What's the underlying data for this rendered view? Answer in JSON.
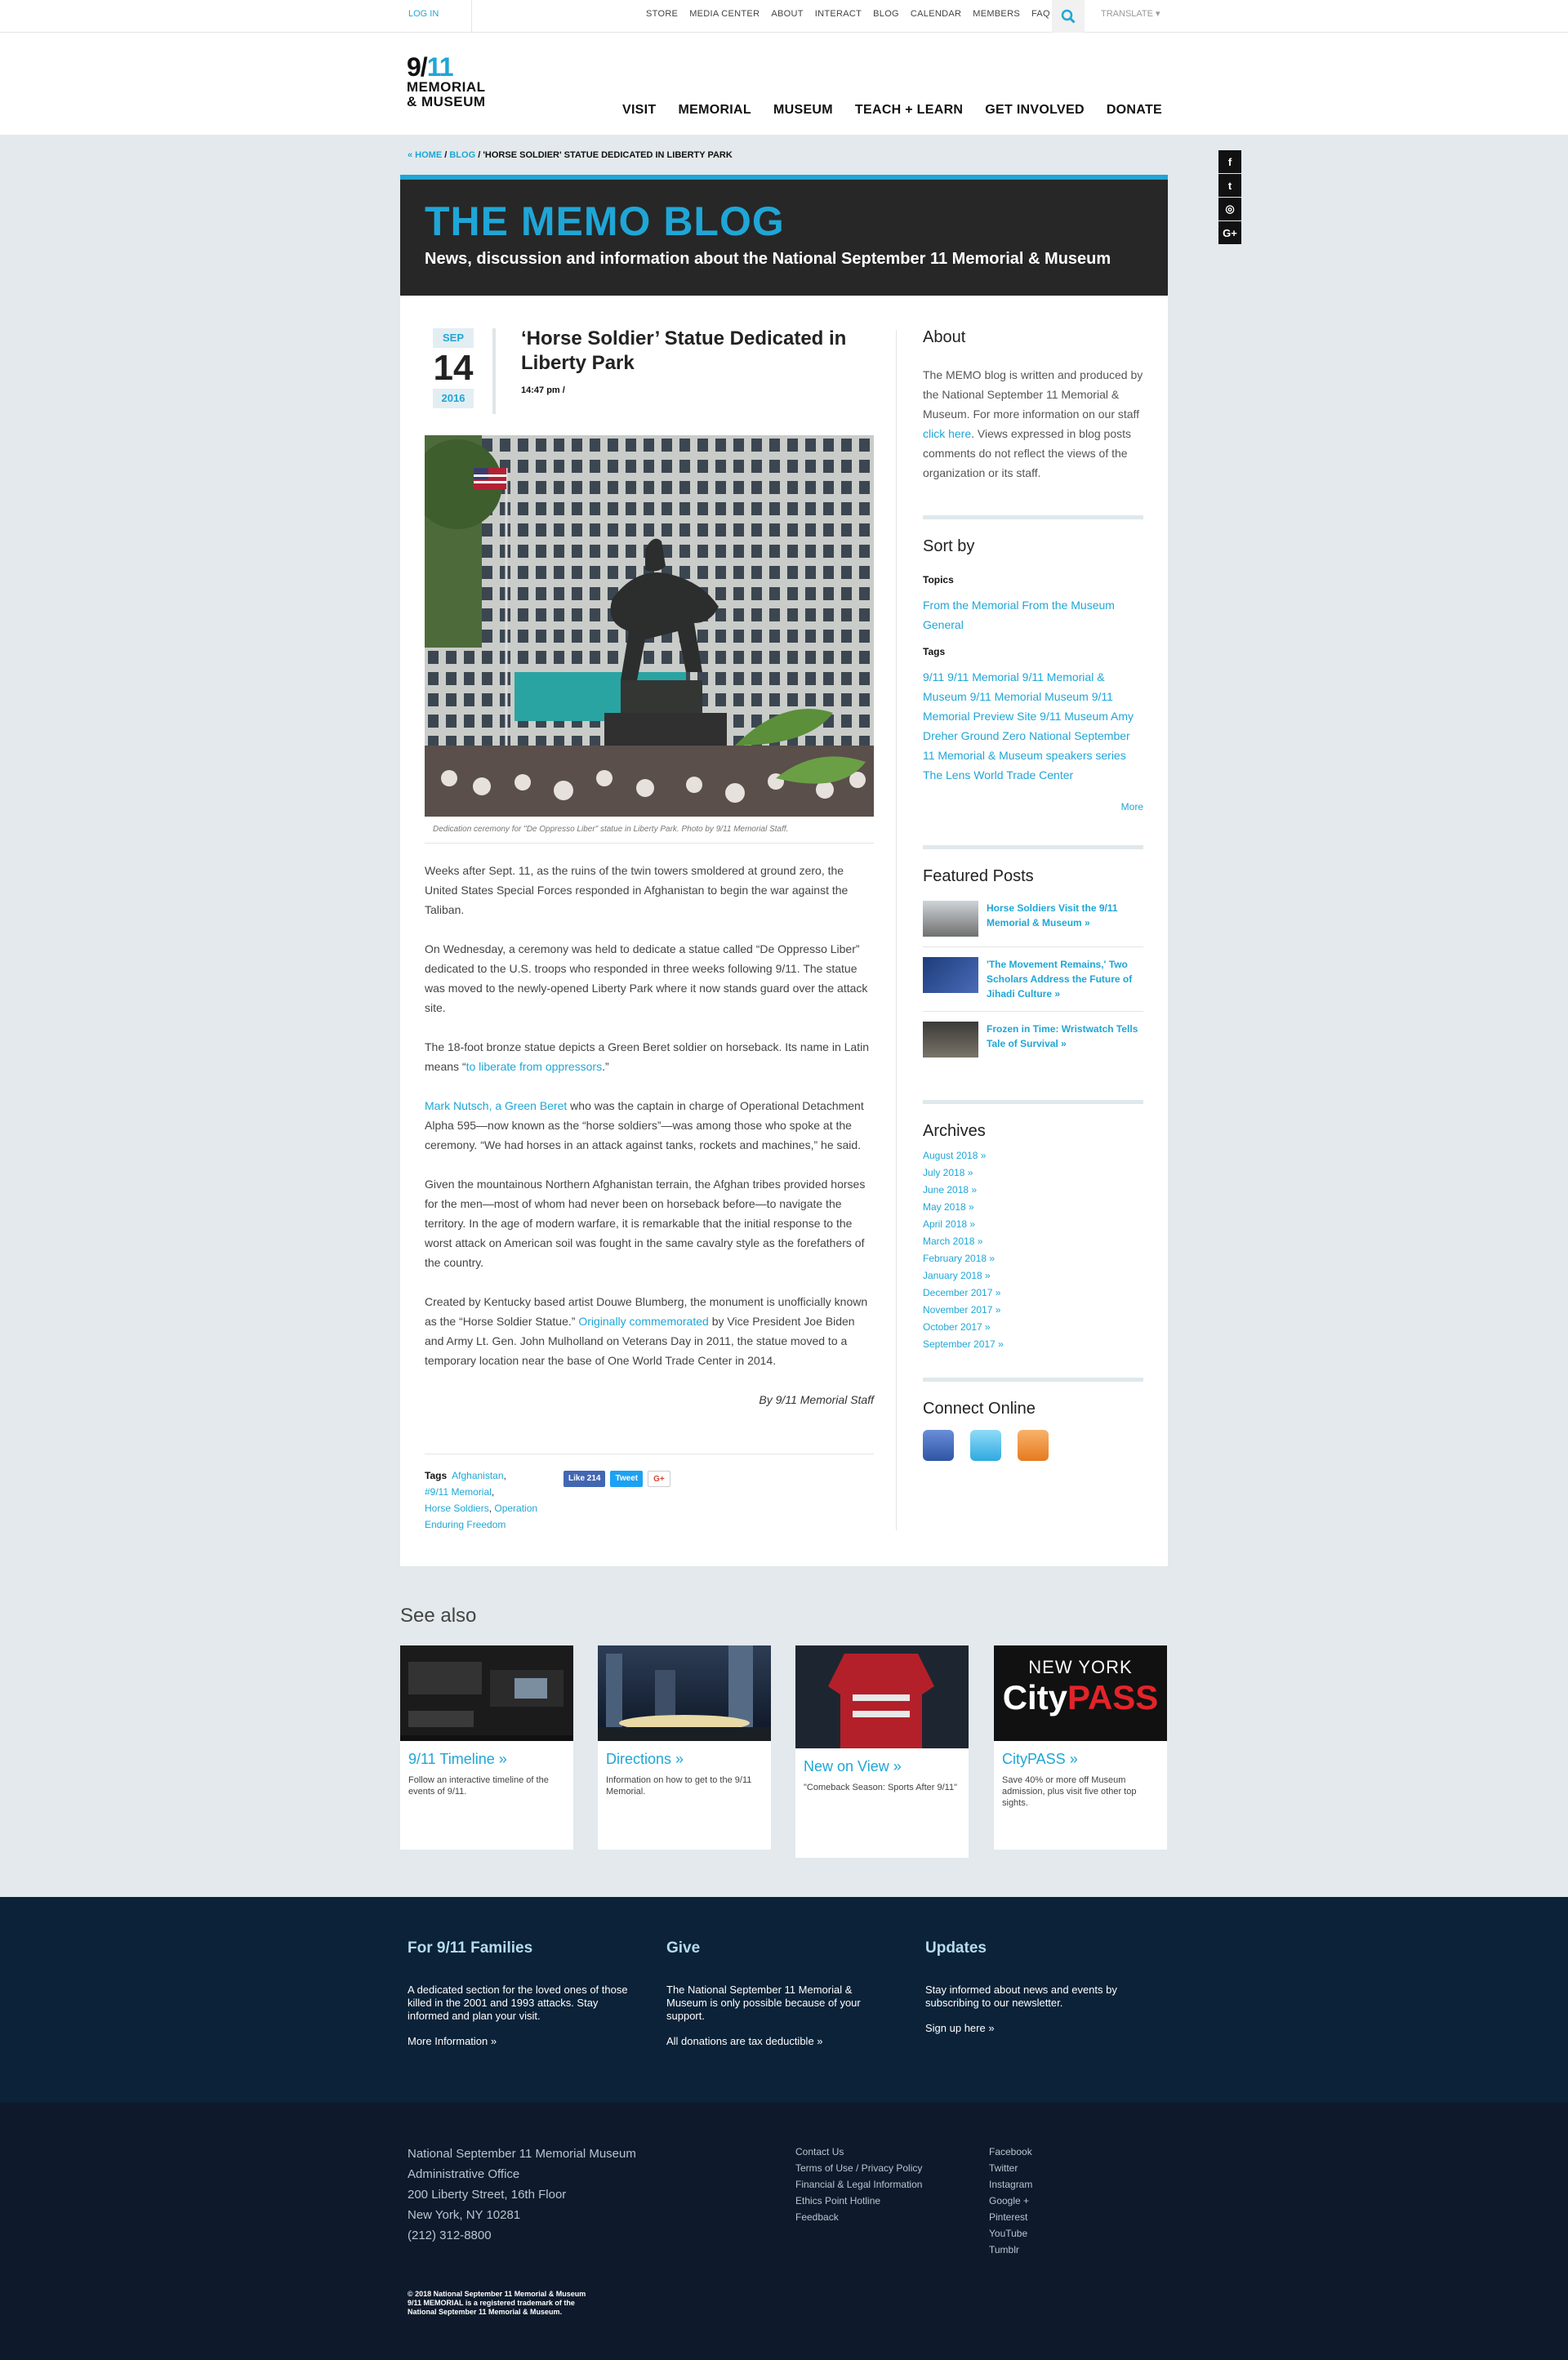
{
  "util": {
    "login": "LOG IN",
    "links": [
      "STORE",
      "MEDIA CENTER",
      "ABOUT",
      "INTERACT",
      "BLOG",
      "CALENDAR",
      "MEMBERS",
      "FAQ"
    ],
    "translate": "TRANSLATE ▾"
  },
  "logo": {
    "line1a": "9/",
    "line1b": "11",
    "line2": "MEMORIAL",
    "line3": "& MUSEUM"
  },
  "nav": [
    "VISIT",
    "MEMORIAL",
    "MUSEUM",
    "TEACH + LEARN",
    "GET INVOLVED",
    "DONATE"
  ],
  "breadcrumb": {
    "home": "« HOME",
    "blog": "BLOG",
    "sep": " / ",
    "current": "'HORSE SOLDIER' STATUE DEDICATED IN LIBERTY PARK"
  },
  "social_bar": [
    "f",
    "t",
    "◎",
    "G+"
  ],
  "banner": {
    "title": "THE MEMO BLOG",
    "subtitle": "News, discussion and information about the National September 11 Memorial & Museum"
  },
  "article": {
    "month": "SEP",
    "day": "14",
    "year": "2016",
    "title": "‘Horse Soldier’ Statue Dedicated in Liberty Park",
    "time": "14:47 pm /",
    "caption": "Dedication ceremony for \"De Oppresso Liber\" statue in Liberty Park. Photo by 9/11 Memorial Staff.",
    "p1": "Weeks after Sept. 11, as the ruins of the twin towers smoldered at ground zero, the United States Special Forces responded in Afghanistan to begin the war against the Taliban.",
    "p2": "On Wednesday, a ceremony was held to dedicate a statue called “De Oppresso Liber” dedicated to the U.S. troops who responded in three weeks following 9/11. The statue was moved to the newly-opened Liberty Park where it now stands guard over the attack site.",
    "p3a": "The 18-foot bronze statue depicts a Green Beret soldier on horseback. Its name in Latin means “",
    "p3link": "to liberate from oppressors",
    "p3b": ".”",
    "p4link": "Mark Nutsch, a Green Beret",
    "p4": " who was the captain in charge of Operational Detachment Alpha 595—now known as the “horse soldiers”—was among those who spoke at the ceremony. “We had horses in an attack against tanks, rockets and machines,” he said.",
    "p5": "Given the mountainous Northern Afghanistan terrain, the Afghan tribes provided horses for the men—most of whom had never been on horseback before—to navigate the territory. In the age of modern warfare, it is remarkable that the initial response to the worst attack on American soil was fought in the same cavalry style as the forefathers of the country.",
    "p6a": "Created by Kentucky based artist Douwe Blumberg, the monument is unofficially known as the “Horse Soldier Statue.” ",
    "p6link": "Originally commemorated",
    "p6b": " by Vice President Joe Biden and Army Lt. Gen. John Mulholland on Veterans Day in 2011, the statue moved to a temporary location near the base of One World Trade Center in 2014.",
    "byline": "By 9/11 Memorial Staff",
    "tags_label": "Tags",
    "tags": [
      "Afghanistan",
      "#9/11 Memorial",
      "Horse Soldiers",
      "Operation Enduring Freedom"
    ],
    "share": {
      "like": "Like 214",
      "tweet": "Tweet",
      "gplus": "G+"
    }
  },
  "sidebar": {
    "about_title": "About",
    "about_a": "The MEMO blog is written and produced by the National September 11 Memorial & Museum. For more information on our staff ",
    "about_link": "click here",
    "about_b": ". Views expressed in blog posts comments do not reflect the views of the organization or its staff.",
    "sort_title": "Sort by",
    "topics_label": "Topics",
    "topics": "From the Memorial From the Museum General",
    "tags_label": "Tags",
    "tags": "9/11 9/11 Memorial 9/11 Memorial & Museum 9/11 Memorial Museum 9/11 Memorial Preview Site 9/11 Museum Amy Dreher Ground Zero National September 11 Memorial & Museum speakers series The Lens World Trade Center",
    "more": "More",
    "featured_title": "Featured Posts",
    "featured": [
      "Horse Soldiers Visit the 9/11 Memorial & Museum »",
      "'The Movement Remains,' Two Scholars Address the Future of Jihadi Culture »",
      "Frozen in Time: Wristwatch Tells Tale of Survival »"
    ],
    "archives_title": "Archives",
    "archives": [
      "August 2018 »",
      "July 2018 »",
      "June 2018 »",
      "May 2018 »",
      "April 2018 »",
      "March 2018 »",
      "February 2018 »",
      "January 2018 »",
      "December 2017 »",
      "November 2017 »",
      "October 2017 »",
      "September 2017 »"
    ],
    "connect_title": "Connect Online"
  },
  "seealso": {
    "title": "See also",
    "tiles": [
      {
        "title": "9/11 Timeline »",
        "desc": "Follow an interactive timeline of the events of 9/11."
      },
      {
        "title": "Directions »",
        "desc": "Information on how to get to the 9/11 Memorial."
      },
      {
        "title": "New on View »",
        "desc": "\"Comeback Season: Sports After 9/11\""
      },
      {
        "title": "CityPASS »",
        "desc": "Save 40% or more off Museum admission, plus visit five other top sights."
      }
    ],
    "citypass_top": "NEW YORK",
    "citypass_a": "City",
    "citypass_b": "PASS"
  },
  "footer": {
    "families_title": "For 9/11 Families",
    "families_text": "A dedicated section for the loved ones of those killed in the 2001 and 1993 attacks. Stay informed and plan your visit.",
    "families_link": "More Information »",
    "give_title": "Give",
    "give_text": "The National September 11 Memorial & Museum is only possible because of your support.",
    "give_link": "All donations are tax deductible »",
    "updates_title": "Updates",
    "updates_text": "Stay informed about news and events by subscribing to our newsletter.",
    "updates_link": "Sign up here »",
    "address": [
      "National September 11 Memorial Museum",
      "Administrative Office",
      "200 Liberty Street, 16th Floor",
      "New York, NY 10281",
      "(212) 312-8800"
    ],
    "links1": [
      "Contact Us",
      "Terms of Use / Privacy Policy",
      "Financial & Legal Information",
      "Ethics Point Hotline",
      "Feedback"
    ],
    "links2": [
      "Facebook",
      "Twitter",
      "Instagram",
      "Google +",
      "Pinterest",
      "YouTube",
      "Tumblr"
    ],
    "copyright": [
      "© 2018 National September 11 Memorial & Museum",
      "9/11 MEMORIAL is a registered trademark of the",
      "National September 11 Memorial & Museum."
    ]
  }
}
